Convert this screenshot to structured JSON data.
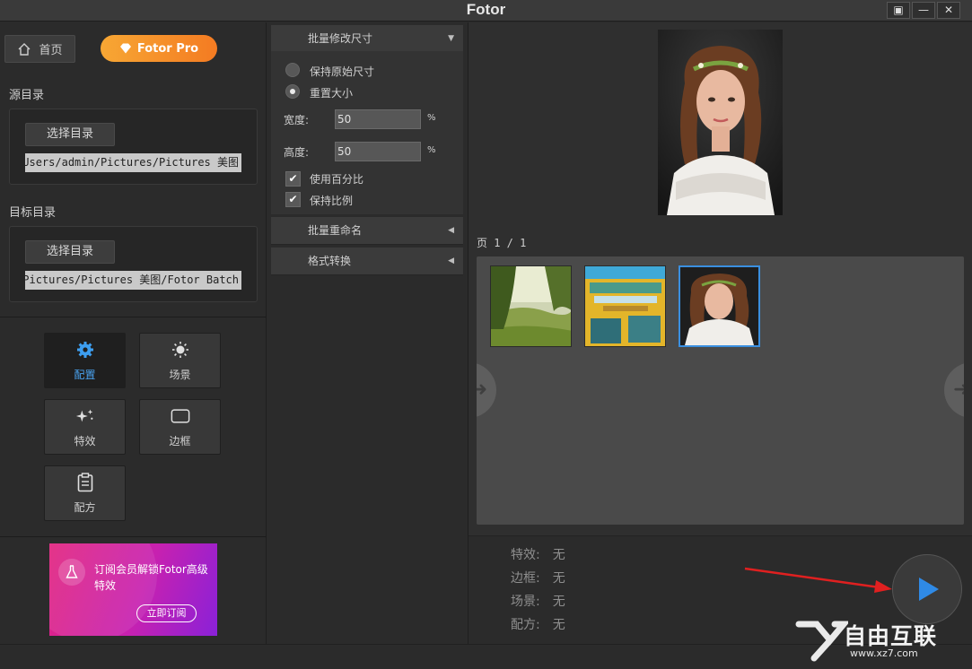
{
  "window": {
    "title": "Fotor",
    "controls": [
      "restore",
      "minimize",
      "close"
    ]
  },
  "left": {
    "home_label": "首页",
    "pro_label": "Fotor Pro",
    "source_dir": {
      "label": "源目录",
      "button": "选择目录",
      "path": "Users/admin/Pictures/Pictures 美图"
    },
    "target_dir": {
      "label": "目标目录",
      "button": "选择目录",
      "path": "Pictures/Pictures 美图/Fotor Batch"
    },
    "tools": [
      {
        "label": "配置",
        "icon": "gear-icon",
        "active": true
      },
      {
        "label": "场景",
        "icon": "sun-icon",
        "active": false
      },
      {
        "label": "特效",
        "icon": "sparkles-icon",
        "active": false
      },
      {
        "label": "边框",
        "icon": "frame-icon",
        "active": false
      },
      {
        "label": "配方",
        "icon": "clipboard-icon",
        "active": false
      }
    ],
    "promo": {
      "text": "订阅会员解锁Fotor高级特效",
      "button": "立即订阅",
      "icon": "flask-icon"
    }
  },
  "middle": {
    "resize": {
      "header": "批量修改尺寸",
      "option_keep": "保持原始尺寸",
      "option_resize": "重置大小",
      "selected": "重置大小",
      "width_label": "宽度:",
      "width_value": "50",
      "height_label": "高度:",
      "height_value": "50",
      "unit": "%",
      "use_percent": "使用百分比",
      "use_percent_checked": true,
      "keep_ratio": "保持比例",
      "keep_ratio_checked": true
    },
    "rename_header": "批量重命名",
    "convert_header": "格式转换"
  },
  "right": {
    "page_indicator": "页 1 / 1",
    "thumbnails": [
      "forest-landscape",
      "colorful-buildings",
      "woman-portrait"
    ],
    "selected_thumbnail": "woman-portrait",
    "info": [
      {
        "label": "特效:",
        "value": "无"
      },
      {
        "label": "边框:",
        "value": "无"
      },
      {
        "label": "场景:",
        "value": "无"
      },
      {
        "label": "配方:",
        "value": "无"
      }
    ],
    "start_icon": "play-icon"
  },
  "watermark": {
    "text": "自由互联",
    "url": "www.xz7.com"
  },
  "colors": {
    "accent": "#3a8fe0",
    "pro_gradient_start": "#f7a734",
    "pro_gradient_end": "#f47b22",
    "play": "#2f8ae6",
    "annotation_arrow": "#e02020"
  }
}
